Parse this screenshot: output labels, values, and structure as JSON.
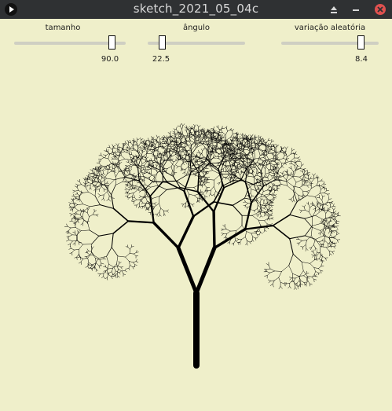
{
  "window": {
    "title": "sketch_2021_05_04c"
  },
  "controls": {
    "size_slider": {
      "label": "tamanho",
      "value": "90.0",
      "level": 0.9
    },
    "angle_slider": {
      "label": "ângulo",
      "value": "22.5",
      "level": 0.12
    },
    "random_slider": {
      "label": "variação aleatória",
      "value": "8.4",
      "level": 0.84
    }
  },
  "colors": {
    "background": "#efefca",
    "titlebar": "#2f3133",
    "close_button": "#e0514f",
    "branch": "#000000"
  }
}
